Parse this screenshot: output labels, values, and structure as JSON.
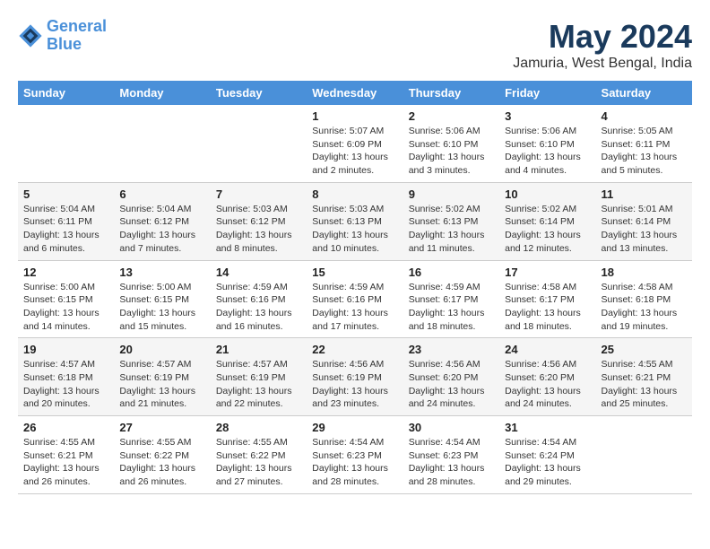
{
  "header": {
    "logo_line1": "General",
    "logo_line2": "Blue",
    "title": "May 2024",
    "subtitle": "Jamuria, West Bengal, India"
  },
  "days_of_week": [
    "Sunday",
    "Monday",
    "Tuesday",
    "Wednesday",
    "Thursday",
    "Friday",
    "Saturday"
  ],
  "weeks": [
    [
      {
        "day": "",
        "info": ""
      },
      {
        "day": "",
        "info": ""
      },
      {
        "day": "",
        "info": ""
      },
      {
        "day": "1",
        "info": "Sunrise: 5:07 AM\nSunset: 6:09 PM\nDaylight: 13 hours and 2 minutes."
      },
      {
        "day": "2",
        "info": "Sunrise: 5:06 AM\nSunset: 6:10 PM\nDaylight: 13 hours and 3 minutes."
      },
      {
        "day": "3",
        "info": "Sunrise: 5:06 AM\nSunset: 6:10 PM\nDaylight: 13 hours and 4 minutes."
      },
      {
        "day": "4",
        "info": "Sunrise: 5:05 AM\nSunset: 6:11 PM\nDaylight: 13 hours and 5 minutes."
      }
    ],
    [
      {
        "day": "5",
        "info": "Sunrise: 5:04 AM\nSunset: 6:11 PM\nDaylight: 13 hours and 6 minutes."
      },
      {
        "day": "6",
        "info": "Sunrise: 5:04 AM\nSunset: 6:12 PM\nDaylight: 13 hours and 7 minutes."
      },
      {
        "day": "7",
        "info": "Sunrise: 5:03 AM\nSunset: 6:12 PM\nDaylight: 13 hours and 8 minutes."
      },
      {
        "day": "8",
        "info": "Sunrise: 5:03 AM\nSunset: 6:13 PM\nDaylight: 13 hours and 10 minutes."
      },
      {
        "day": "9",
        "info": "Sunrise: 5:02 AM\nSunset: 6:13 PM\nDaylight: 13 hours and 11 minutes."
      },
      {
        "day": "10",
        "info": "Sunrise: 5:02 AM\nSunset: 6:14 PM\nDaylight: 13 hours and 12 minutes."
      },
      {
        "day": "11",
        "info": "Sunrise: 5:01 AM\nSunset: 6:14 PM\nDaylight: 13 hours and 13 minutes."
      }
    ],
    [
      {
        "day": "12",
        "info": "Sunrise: 5:00 AM\nSunset: 6:15 PM\nDaylight: 13 hours and 14 minutes."
      },
      {
        "day": "13",
        "info": "Sunrise: 5:00 AM\nSunset: 6:15 PM\nDaylight: 13 hours and 15 minutes."
      },
      {
        "day": "14",
        "info": "Sunrise: 4:59 AM\nSunset: 6:16 PM\nDaylight: 13 hours and 16 minutes."
      },
      {
        "day": "15",
        "info": "Sunrise: 4:59 AM\nSunset: 6:16 PM\nDaylight: 13 hours and 17 minutes."
      },
      {
        "day": "16",
        "info": "Sunrise: 4:59 AM\nSunset: 6:17 PM\nDaylight: 13 hours and 18 minutes."
      },
      {
        "day": "17",
        "info": "Sunrise: 4:58 AM\nSunset: 6:17 PM\nDaylight: 13 hours and 18 minutes."
      },
      {
        "day": "18",
        "info": "Sunrise: 4:58 AM\nSunset: 6:18 PM\nDaylight: 13 hours and 19 minutes."
      }
    ],
    [
      {
        "day": "19",
        "info": "Sunrise: 4:57 AM\nSunset: 6:18 PM\nDaylight: 13 hours and 20 minutes."
      },
      {
        "day": "20",
        "info": "Sunrise: 4:57 AM\nSunset: 6:19 PM\nDaylight: 13 hours and 21 minutes."
      },
      {
        "day": "21",
        "info": "Sunrise: 4:57 AM\nSunset: 6:19 PM\nDaylight: 13 hours and 22 minutes."
      },
      {
        "day": "22",
        "info": "Sunrise: 4:56 AM\nSunset: 6:19 PM\nDaylight: 13 hours and 23 minutes."
      },
      {
        "day": "23",
        "info": "Sunrise: 4:56 AM\nSunset: 6:20 PM\nDaylight: 13 hours and 24 minutes."
      },
      {
        "day": "24",
        "info": "Sunrise: 4:56 AM\nSunset: 6:20 PM\nDaylight: 13 hours and 24 minutes."
      },
      {
        "day": "25",
        "info": "Sunrise: 4:55 AM\nSunset: 6:21 PM\nDaylight: 13 hours and 25 minutes."
      }
    ],
    [
      {
        "day": "26",
        "info": "Sunrise: 4:55 AM\nSunset: 6:21 PM\nDaylight: 13 hours and 26 minutes."
      },
      {
        "day": "27",
        "info": "Sunrise: 4:55 AM\nSunset: 6:22 PM\nDaylight: 13 hours and 26 minutes."
      },
      {
        "day": "28",
        "info": "Sunrise: 4:55 AM\nSunset: 6:22 PM\nDaylight: 13 hours and 27 minutes."
      },
      {
        "day": "29",
        "info": "Sunrise: 4:54 AM\nSunset: 6:23 PM\nDaylight: 13 hours and 28 minutes."
      },
      {
        "day": "30",
        "info": "Sunrise: 4:54 AM\nSunset: 6:23 PM\nDaylight: 13 hours and 28 minutes."
      },
      {
        "day": "31",
        "info": "Sunrise: 4:54 AM\nSunset: 6:24 PM\nDaylight: 13 hours and 29 minutes."
      },
      {
        "day": "",
        "info": ""
      }
    ]
  ]
}
